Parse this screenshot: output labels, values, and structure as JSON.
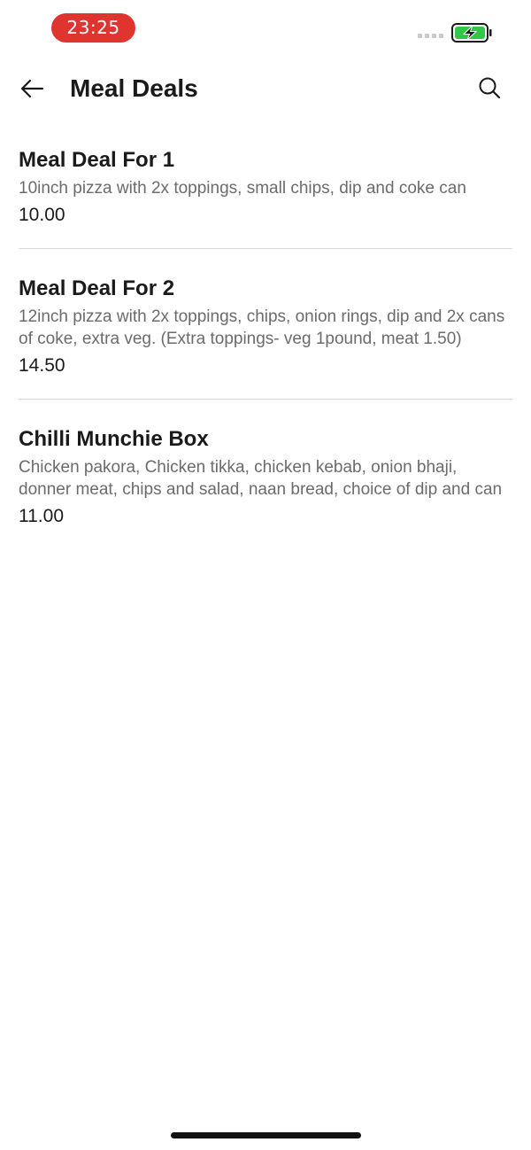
{
  "status_bar": {
    "time": "23:25",
    "colors": {
      "time_pill": "#e0342f",
      "battery_fill": "#33c748"
    }
  },
  "header": {
    "title": "Meal Deals",
    "back_icon": "arrow-left-icon",
    "search_icon": "search-icon"
  },
  "deals": [
    {
      "name": "Meal Deal For 1",
      "description": "10inch pizza with 2x toppings, small chips, dip and coke can",
      "price": "10.00"
    },
    {
      "name": "Meal Deal For 2",
      "description": "12inch pizza with 2x toppings, chips, onion rings, dip and 2x cans of coke, extra veg. (Extra toppings- veg 1pound, meat 1.50)",
      "price": "14.50"
    },
    {
      "name": "Chilli Munchie Box",
      "description": "Chicken pakora, Chicken tikka, chicken kebab, onion bhaji, donner meat, chips and salad, naan bread, choice of dip and can",
      "price": "11.00"
    }
  ]
}
